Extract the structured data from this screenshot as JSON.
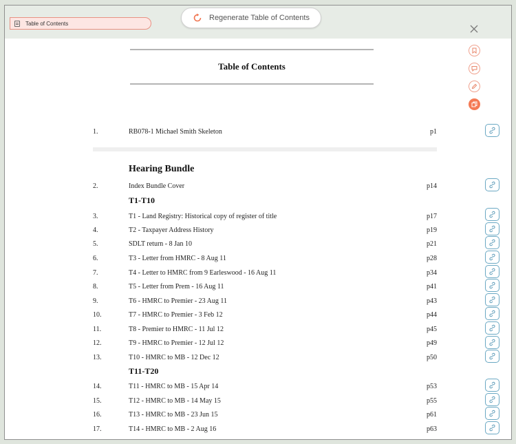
{
  "tab": {
    "label": "Table of Contents"
  },
  "toolbar": {
    "regenerate_label": "Regenerate Table of Contents"
  },
  "document": {
    "title": "Table of Contents"
  },
  "sections": {
    "hearing_bundle": "Hearing Bundle",
    "t1_t10": "T1-T10",
    "t11_t20": "T11-T20"
  },
  "entries": [
    {
      "num": "1.",
      "title": "RB078-1 Michael Smith Skeleton",
      "page": "p1"
    },
    {
      "num": "2.",
      "title": "Index Bundle Cover",
      "page": "p14"
    },
    {
      "num": "3.",
      "title": "T1 - Land Registry: Historical copy of register of title",
      "page": "p17"
    },
    {
      "num": "4.",
      "title": "T2 - Taxpayer Address History",
      "page": "p19"
    },
    {
      "num": "5.",
      "title": "SDLT return - 8 Jan 10",
      "page": "p21"
    },
    {
      "num": "6.",
      "title": "T3 - Letter from HMRC - 8 Aug 11",
      "page": "p28"
    },
    {
      "num": "7.",
      "title": "T4 - Letter to HMRC from 9 Earleswood - 16 Aug 11",
      "page": "p34"
    },
    {
      "num": "8.",
      "title": "T5 - Letter from Prem - 16 Aug 11",
      "page": "p41"
    },
    {
      "num": "9.",
      "title": "T6 - HMRC to Premier - 23 Aug 11",
      "page": "p43"
    },
    {
      "num": "10.",
      "title": "T7 - HMRC to Premier - 3 Feb 12",
      "page": "p44"
    },
    {
      "num": "11.",
      "title": "T8 - Premier to HMRC - 11 Jul 12",
      "page": "p45"
    },
    {
      "num": "12.",
      "title": "T9 - HMRC to Premier - 12 Jul 12",
      "page": "p49"
    },
    {
      "num": "13.",
      "title": "T10 - HMRC to MB - 12 Dec 12",
      "page": "p50"
    },
    {
      "num": "14.",
      "title": "T11 - HMRC to MB - 15 Apr 14",
      "page": "p53"
    },
    {
      "num": "15.",
      "title": "T12 - HMRC to MB - 14 May 15",
      "page": "p55"
    },
    {
      "num": "16.",
      "title": "T13 - HMRC to MB - 23 Jun 15",
      "page": "p61"
    },
    {
      "num": "17.",
      "title": "T14 - HMRC to MB - 2 Aug 16",
      "page": "p63"
    }
  ],
  "icons": {
    "tab": "toc-list-icon",
    "regenerate": "refresh-icon",
    "close": "close-icon",
    "side": [
      "bookmark-icon",
      "comment-icon",
      "edit-icon",
      "copy-icon"
    ],
    "row_action": "link-icon"
  },
  "colors": {
    "accent": "#f47a55",
    "tab_bg": "#fde6e3",
    "link_border": "#6aa8c3"
  }
}
